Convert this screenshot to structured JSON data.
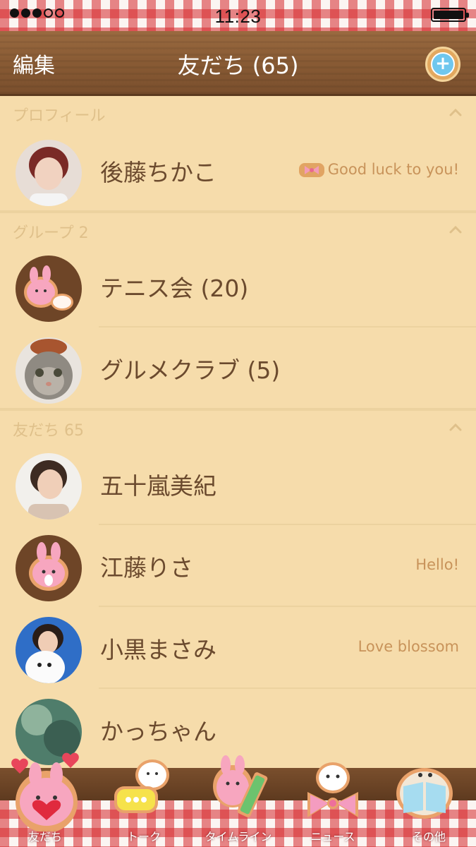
{
  "status_bar": {
    "time": "11:23",
    "signal_dots": [
      true,
      true,
      true,
      false,
      false
    ]
  },
  "nav": {
    "edit_label": "編集",
    "title": "友だち (65)",
    "add_icon": "add-friend-icon"
  },
  "sections": {
    "profile": {
      "label": "プロフィール",
      "rows": [
        {
          "name": "後藤ちかこ",
          "status": "Good luck to you!",
          "avatar": "photo-woman-red-hair"
        }
      ]
    },
    "groups": {
      "label": "グループ 2",
      "rows": [
        {
          "name": "テニス会 (20)",
          "status": "",
          "avatar": "pink-bunny-cookie"
        },
        {
          "name": "グルメクラブ (5)",
          "status": "",
          "avatar": "photo-cat"
        }
      ]
    },
    "friends": {
      "label": "友だち 65",
      "rows": [
        {
          "name": "五十嵐美紀",
          "status": "",
          "avatar": "photo-woman-short-hair"
        },
        {
          "name": "江藤りさ",
          "status": "Hello!",
          "avatar": "pink-bunny-cookie"
        },
        {
          "name": "小黒まさみ",
          "status": "Love blossom",
          "avatar": "photo-woman-dog"
        },
        {
          "name": "かっちゃん",
          "status": "",
          "avatar": "photo-landscape"
        }
      ]
    }
  },
  "tabs": [
    {
      "label": "友だち",
      "icon": "bunny-heart-icon",
      "active": true
    },
    {
      "label": "トーク",
      "icon": "chat-bubble-icon",
      "active": false
    },
    {
      "label": "タイムライン",
      "icon": "bunny-pencil-icon",
      "active": false
    },
    {
      "label": "ニュース",
      "icon": "bird-ribbon-icon",
      "active": false
    },
    {
      "label": "その他",
      "icon": "book-icon",
      "active": false
    }
  ],
  "colors": {
    "background": "#f6dcab",
    "text": "#6b4a2e",
    "status_text": "#c8935a",
    "section_label": "#dfc08a",
    "wood": "#8a5c35",
    "gingham_red": "#d6282c"
  }
}
